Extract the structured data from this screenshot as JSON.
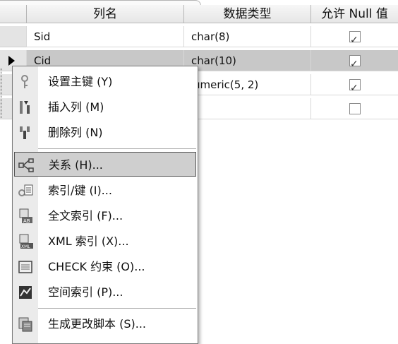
{
  "columns": {
    "name": "列名",
    "type": "数据类型",
    "nullable": "允许 Null 值"
  },
  "rows": [
    {
      "name": "Sid",
      "type": "char(8)",
      "nullable": true,
      "current": false
    },
    {
      "name": "Cid",
      "type": "char(10)",
      "nullable": true,
      "current": true
    },
    {
      "name": "",
      "type": "umeric(5, 2)",
      "nullable": true,
      "current": false
    },
    {
      "name": "",
      "type": "",
      "nullable": false,
      "current": false
    }
  ],
  "menu": {
    "items": [
      {
        "label": "设置主键 (Y)",
        "icon": "key-icon"
      },
      {
        "label": "插入列 (M)",
        "icon": "insert-column-icon"
      },
      {
        "label": "删除列 (N)",
        "icon": "delete-column-icon"
      },
      {
        "label": "关系 (H)...",
        "icon": "relationship-icon",
        "highlighted": true
      },
      {
        "label": "索引/键 (I)...",
        "icon": "index-key-icon"
      },
      {
        "label": "全文索引 (F)...",
        "icon": "fulltext-index-icon"
      },
      {
        "label": "XML 索引 (X)...",
        "icon": "xml-index-icon"
      },
      {
        "label": "CHECK 约束 (O)...",
        "icon": "check-constraint-icon"
      },
      {
        "label": "空间索引 (P)...",
        "icon": "spatial-index-icon"
      },
      {
        "label": "生成更改脚本 (S)...",
        "icon": "generate-script-icon"
      }
    ]
  }
}
